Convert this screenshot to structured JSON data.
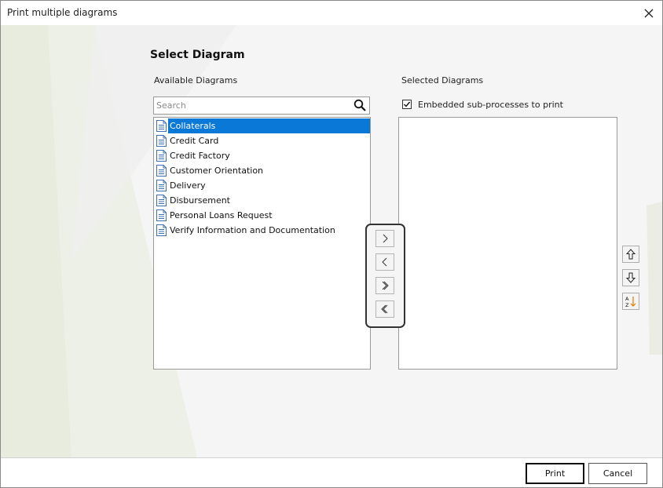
{
  "window": {
    "title": "Print multiple diagrams",
    "close_icon": "close-icon"
  },
  "heading": "Select Diagram",
  "available": {
    "label": "Available Diagrams",
    "search": {
      "placeholder": "Search",
      "value": ""
    },
    "items": [
      {
        "label": "Collaterals",
        "selected": true
      },
      {
        "label": "Credit Card",
        "selected": false
      },
      {
        "label": "Credit Factory",
        "selected": false
      },
      {
        "label": "Customer Orientation",
        "selected": false
      },
      {
        "label": "Delivery",
        "selected": false
      },
      {
        "label": "Disbursement",
        "selected": false
      },
      {
        "label": "Personal Loans Request",
        "selected": false
      },
      {
        "label": "Verify Information and Documentation",
        "selected": false
      }
    ]
  },
  "selected": {
    "label": "Selected Diagrams",
    "embedded": {
      "label": "Embedded sub-processes to print",
      "checked": true
    },
    "items": []
  },
  "move_buttons": [
    "move-right-icon",
    "move-left-icon",
    "move-all-right-icon",
    "move-all-left-icon"
  ],
  "order_buttons": [
    "move-up-icon",
    "move-down-icon",
    "sort-az-icon"
  ],
  "footer": {
    "print_label": "Print",
    "cancel_label": "Cancel"
  },
  "colors": {
    "selection": "#0a78d7",
    "sort_accent": "#e07b00",
    "doc_icon": "#3b6fb5"
  }
}
